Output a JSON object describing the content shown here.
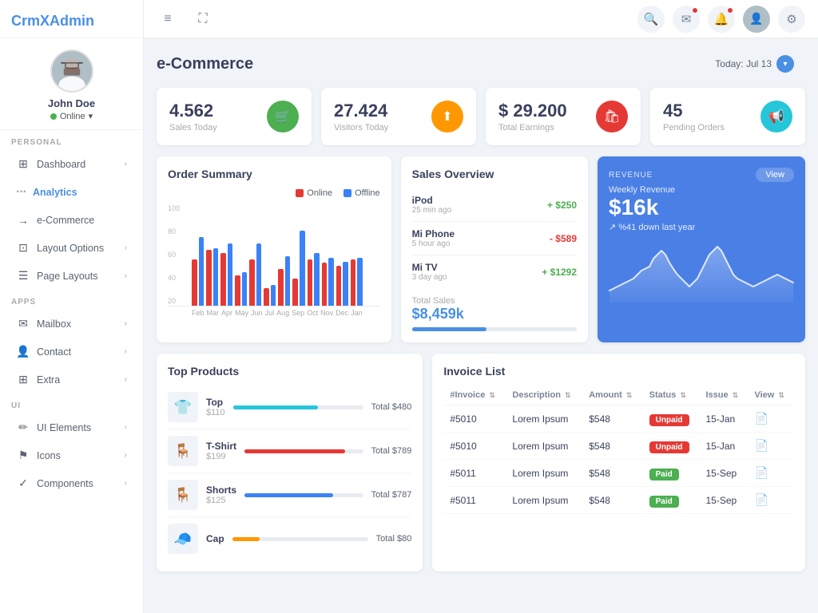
{
  "app": {
    "name": "CrmX",
    "name2": "Admin"
  },
  "user": {
    "name": "John Doe",
    "status": "Online",
    "avatar_emoji": "👤"
  },
  "sidebar": {
    "personal_label": "PERSONAL",
    "apps_label": "APPS",
    "ui_label": "UI",
    "items": [
      {
        "id": "dashboard",
        "label": "Dashboard",
        "icon": "⊞",
        "has_chevron": true
      },
      {
        "id": "analytics",
        "label": "Analytics",
        "icon": "···",
        "is_dots": true
      },
      {
        "id": "ecommerce",
        "label": "e-Commerce",
        "icon": "→",
        "active": true
      },
      {
        "id": "layout-options",
        "label": "Layout Options",
        "icon": "⊡",
        "has_chevron": true
      },
      {
        "id": "page-layouts",
        "label": "Page Layouts",
        "icon": "☰",
        "has_chevron": true
      },
      {
        "id": "mailbox",
        "label": "Mailbox",
        "icon": "✉",
        "has_chevron": true
      },
      {
        "id": "contact",
        "label": "Contact",
        "icon": "👤",
        "has_chevron": true
      },
      {
        "id": "extra",
        "label": "Extra",
        "icon": "⊞",
        "has_chevron": true
      },
      {
        "id": "ui-elements",
        "label": "UI Elements",
        "icon": "✏",
        "has_chevron": true
      },
      {
        "id": "icons",
        "label": "Icons",
        "icon": "⚑",
        "has_chevron": true
      },
      {
        "id": "components",
        "label": "Components",
        "icon": "✓",
        "has_chevron": true
      }
    ]
  },
  "topbar": {
    "menu_icon": "≡",
    "expand_icon": "⛶",
    "search_icon": "🔍",
    "mail_icon": "✉",
    "bell_icon": "🔔",
    "gear_icon": "⚙"
  },
  "page_header": {
    "title": "e-Commerce",
    "date_label": "Today: Jul 13"
  },
  "stat_cards": [
    {
      "value": "4.562",
      "label": "Sales Today",
      "icon": "🛒",
      "icon_class": "green"
    },
    {
      "value": "27.424",
      "label": "Visitors Today",
      "icon": "⬆",
      "icon_class": "orange"
    },
    {
      "value": "$ 29.200",
      "label": "Total Earnings",
      "icon": "🛍",
      "icon_class": "red"
    },
    {
      "value": "45",
      "label": "Pending Orders",
      "icon": "📢",
      "icon_class": "teal"
    }
  ],
  "order_summary": {
    "title": "Order Summary",
    "legend_online": "Online",
    "legend_offline": "Offline",
    "y_labels": [
      "100",
      "80",
      "60",
      "40",
      "20"
    ],
    "months": [
      "Feb",
      "Mar",
      "Apr",
      "May",
      "Jun",
      "Jul",
      "Aug",
      "Sep",
      "Oct",
      "Nov",
      "Dec",
      "Jan"
    ],
    "online_data": [
      48,
      58,
      55,
      32,
      48,
      18,
      38,
      28,
      48,
      45,
      42,
      48
    ],
    "offline_data": [
      72,
      60,
      65,
      35,
      65,
      22,
      52,
      78,
      55,
      50,
      46,
      50
    ]
  },
  "sales_overview": {
    "title": "Sales Overview",
    "items": [
      {
        "name": "iPod",
        "time": "25 min ago",
        "amount": "+ $250",
        "type": "pos"
      },
      {
        "name": "Mi Phone",
        "time": "5 hour ago",
        "amount": "- $589",
        "type": "neg"
      },
      {
        "name": "Mi TV",
        "time": "3 day ago",
        "amount": "+ $1292",
        "type": "pos"
      }
    ],
    "total_label": "Total Sales",
    "total_value": "$8,459k",
    "progress_pct": 45
  },
  "revenue": {
    "label": "REVENUE",
    "weekly_label": "Weekly Revenue",
    "value": "$16k",
    "subtitle": "↗ %41 down last year",
    "view_btn": "View"
  },
  "top_products": {
    "title": "Top Products",
    "items": [
      {
        "name": "Top",
        "price": "$110",
        "total": "Total $480",
        "bar_pct": 65,
        "bar_color": "#26c6da",
        "emoji": "👕"
      },
      {
        "name": "T-Shirt",
        "price": "$199",
        "total": "Total $789",
        "bar_pct": 85,
        "bar_color": "#e53935",
        "emoji": "🪑"
      },
      {
        "name": "Shorts",
        "price": "$125",
        "total": "Total $787",
        "bar_pct": 75,
        "bar_color": "#3b82f6",
        "emoji": "🪑"
      },
      {
        "name": "Cap",
        "price": "",
        "total": "Total $80",
        "bar_pct": 20,
        "bar_color": "#ff9800",
        "emoji": "🧢"
      }
    ]
  },
  "invoice_list": {
    "title": "Invoice List",
    "columns": [
      "#Invoice",
      "Description",
      "Amount",
      "Status",
      "Issue",
      "View"
    ],
    "rows": [
      {
        "invoice": "#5010",
        "description": "Lorem Ipsum",
        "amount": "$548",
        "status": "Unpaid",
        "issue": "15-Jan"
      },
      {
        "invoice": "#5010",
        "description": "Lorem Ipsum",
        "amount": "$548",
        "status": "Unpaid",
        "issue": "15-Jan"
      },
      {
        "invoice": "#5011",
        "description": "Lorem Ipsum",
        "amount": "$548",
        "status": "Paid",
        "issue": "15-Sep"
      },
      {
        "invoice": "#5011",
        "description": "Lorem Ipsum",
        "amount": "$548",
        "status": "Paid",
        "issue": "15-Sep"
      }
    ]
  }
}
